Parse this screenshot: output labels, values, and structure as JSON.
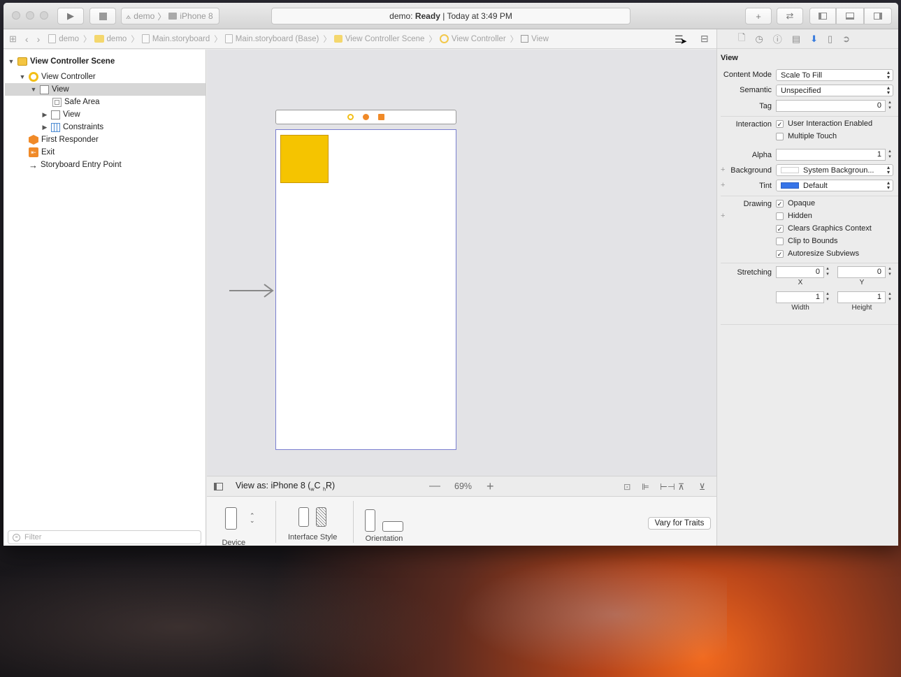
{
  "toolbar": {
    "scheme": "demo",
    "device": "iPhone 8",
    "status_prefix": "demo:",
    "status_state": "Ready",
    "status_time": "| Today at 3:49 PM"
  },
  "jumpbar": {
    "crumbs": [
      "demo",
      "demo",
      "Main.storyboard",
      "Main.storyboard (Base)",
      "View Controller Scene",
      "View Controller",
      "View"
    ]
  },
  "outline": {
    "items": [
      "View Controller Scene",
      "View Controller",
      "View",
      "Safe Area",
      "View",
      "Constraints",
      "First Responder",
      "Exit",
      "Storyboard Entry Point"
    ],
    "filter_placeholder": "Filter"
  },
  "canvas": {
    "view_as": "View as: iPhone 8 (",
    "w_sub": "w",
    "c_label": "C",
    "h_sub": "h",
    "r_label": "R)",
    "zoom": "69%"
  },
  "traits": {
    "device": "Device",
    "interface_style": "Interface Style",
    "orientation": "Orientation",
    "vary_button": "Vary for Traits"
  },
  "inspector": {
    "title": "View",
    "content_mode_label": "Content Mode",
    "content_mode": "Scale To Fill",
    "semantic_label": "Semantic",
    "semantic": "Unspecified",
    "tag_label": "Tag",
    "tag": "0",
    "interaction_label": "Interaction",
    "user_interaction": "User Interaction Enabled",
    "multiple_touch": "Multiple Touch",
    "alpha_label": "Alpha",
    "alpha": "1",
    "background_label": "Background",
    "background": "System Backgroun...",
    "tint_label": "Tint",
    "tint": "Default",
    "drawing_label": "Drawing",
    "opaque": "Opaque",
    "hidden": "Hidden",
    "clears": "Clears Graphics Context",
    "clip": "Clip to Bounds",
    "autoresize": "Autoresize Subviews",
    "stretching_label": "Stretching",
    "x": "0",
    "y": "0",
    "width": "1",
    "height": "1",
    "x_label": "X",
    "y_label": "Y",
    "width_label": "Width",
    "height_label": "Height"
  },
  "colors": {
    "accent": "#3b7ddd",
    "view_yellow": "#f5c400",
    "tint_blue": "#3674e8"
  }
}
